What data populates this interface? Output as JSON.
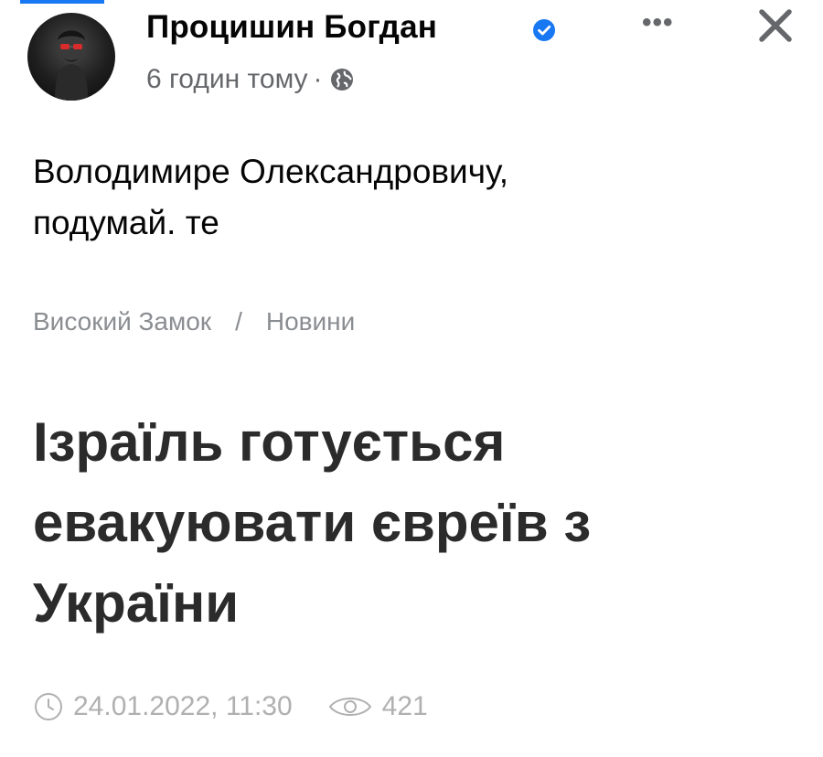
{
  "post": {
    "author": "Процишин Богдан",
    "time": "6 годин тому",
    "separator": "·",
    "more_label": "•••",
    "text_lines": [
      "Володимире Олександровичу,",
      "подумай. те"
    ]
  },
  "article": {
    "breadcrumb": [
      "Високий Замок",
      "/",
      "Новини"
    ],
    "title_lines": [
      "Ізраїль готується",
      "евакуювати євреїв з",
      "України"
    ],
    "date": "24.01.2022, 11:30",
    "views": "421"
  },
  "icons": {
    "verified": "verified-badge-icon",
    "globe": "globe-icon",
    "more": "more-options-icon",
    "close": "close-icon",
    "clock": "clock-icon",
    "eye": "eye-icon"
  },
  "colors": {
    "accent": "#1877f2",
    "secondary_text": "#65676b",
    "breadcrumb": "#8a8d91",
    "title": "#2b2b2b",
    "article_meta": "#b0b0b0"
  }
}
